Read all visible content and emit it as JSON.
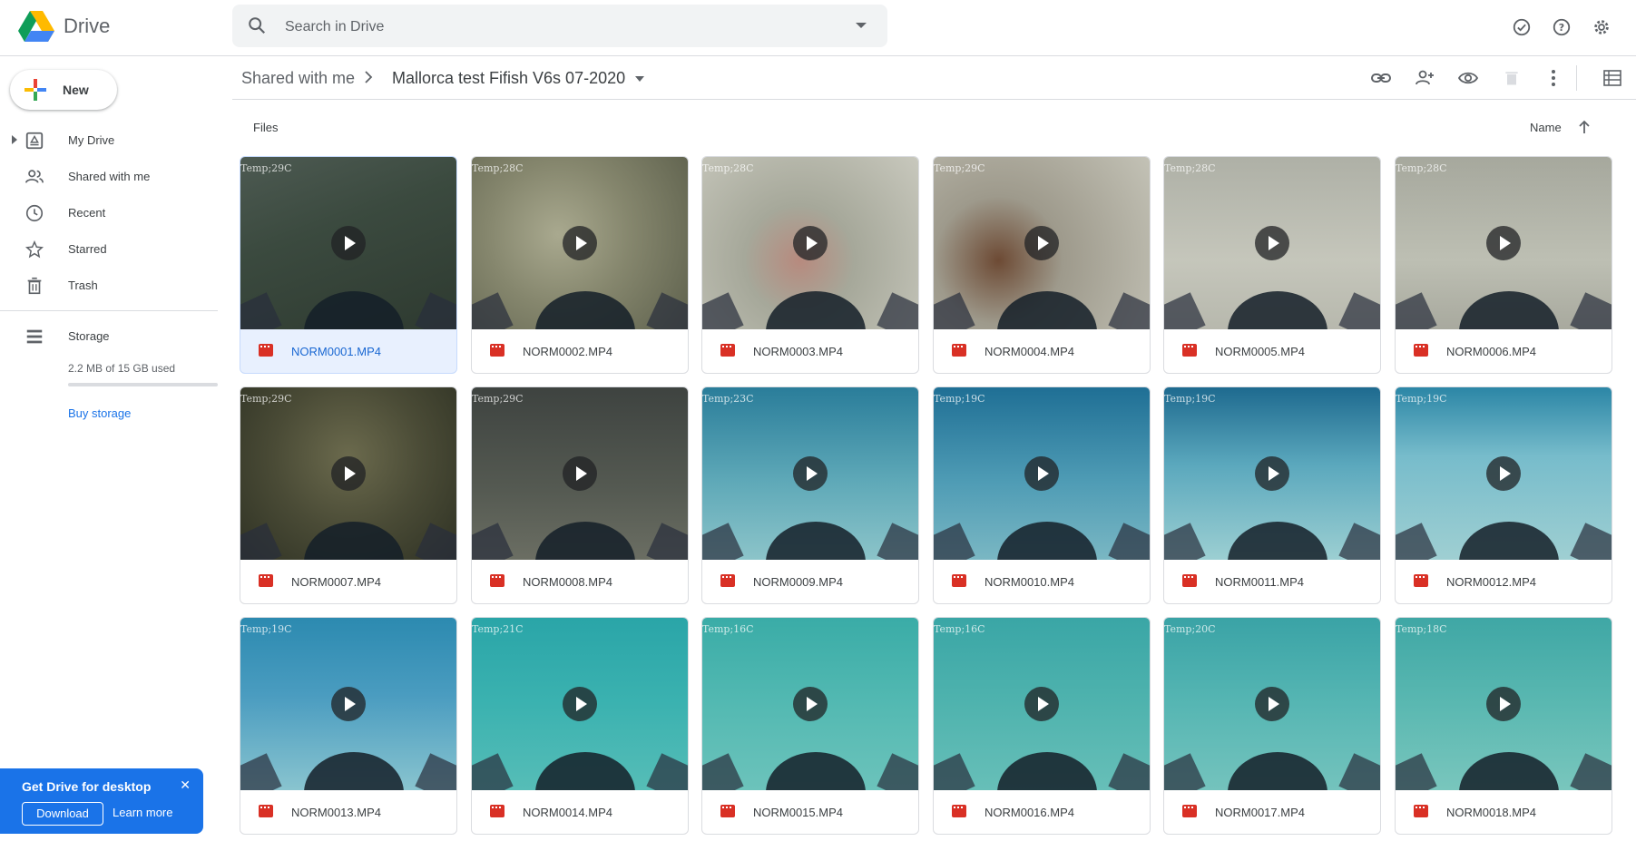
{
  "app": {
    "name": "Drive"
  },
  "search": {
    "placeholder": "Search in Drive"
  },
  "sidebar": {
    "new_label": "New",
    "items": [
      {
        "label": "My Drive"
      },
      {
        "label": "Shared with me"
      },
      {
        "label": "Recent"
      },
      {
        "label": "Starred"
      },
      {
        "label": "Trash"
      }
    ],
    "storage": {
      "label": "Storage",
      "used_text": "2.2 MB of 15 GB used",
      "used_fraction": 0.0001,
      "buy_label": "Buy storage"
    }
  },
  "promo": {
    "title": "Get Drive for desktop",
    "download_label": "Download",
    "learn_more_label": "Learn more"
  },
  "breadcrumb": {
    "parent": "Shared with me",
    "current": "Mallorca test Fifish V6s 07-2020"
  },
  "files_section": {
    "label": "Files",
    "sort_label": "Name"
  },
  "files": [
    {
      "name": "NORM0001.MP4",
      "osd": "Temp;29C",
      "selected": true,
      "bg": "linear-gradient(160deg,#4d5a52 0%,#3b4a3f 40%,#2e3a30 100%)"
    },
    {
      "name": "NORM0002.MP4",
      "osd": "Temp;28C",
      "selected": false,
      "bg": "radial-gradient(circle at 40% 45%,#a9a98f 0%,#85866d 45%,#5e614d 100%)"
    },
    {
      "name": "NORM0003.MP4",
      "osd": "Temp;28C",
      "selected": false,
      "bg": "radial-gradient(circle at 45% 60%,#b78a7e 0%,#a6a89a 35%,#c8c8bd 100%)"
    },
    {
      "name": "NORM0004.MP4",
      "osd": "Temp;29C",
      "selected": false,
      "bg": "radial-gradient(circle at 30% 60%,#6d4a34 0%,#9e9a8c 35%,#c3c2b6 100%)"
    },
    {
      "name": "NORM0005.MP4",
      "osd": "Temp;28C",
      "selected": false,
      "bg": "linear-gradient(180deg,#aeb0a6 0%,#c5c6bb 60%,#b7b8ad 100%)"
    },
    {
      "name": "NORM0006.MP4",
      "osd": "Temp;28C",
      "selected": false,
      "bg": "linear-gradient(180deg,#a6a89d 0%,#bdbfb3 60%,#a8a99e 100%)"
    },
    {
      "name": "NORM0007.MP4",
      "osd": "Temp;29C",
      "selected": false,
      "bg": "radial-gradient(circle at 50% 40%,#6b6a4d 0%,#4a4b36 50%,#2f3224 100%)"
    },
    {
      "name": "NORM0008.MP4",
      "osd": "Temp;29C",
      "selected": false,
      "bg": "linear-gradient(180deg,#3e4340 0%,#555a52 60%,#6b6e63 100%)"
    },
    {
      "name": "NORM0009.MP4",
      "osd": "Temp;23C",
      "selected": false,
      "bg": "linear-gradient(180deg,#2a7d9a 0%,#5fa9b8 55%,#8cc4c9 100%)"
    },
    {
      "name": "NORM0010.MP4",
      "osd": "Temp;19C",
      "selected": false,
      "bg": "linear-gradient(180deg,#1f6f95 0%,#4f9cb5 55%,#7ab7c3 100%)"
    },
    {
      "name": "NORM0011.MP4",
      "osd": "Temp;19C",
      "selected": false,
      "bg": "linear-gradient(180deg,#1e6a8f 0%,#5ba8bd 45%,#9ccfd2 100%)"
    },
    {
      "name": "NORM0012.MP4",
      "osd": "Temp;19C",
      "selected": false,
      "bg": "linear-gradient(180deg,#2b86a6 0%,#77bccb 40%,#9fcfd2 100%)"
    },
    {
      "name": "NORM0013.MP4",
      "osd": "Temp;19C",
      "selected": false,
      "bg": "linear-gradient(180deg,#2c8ab0 0%,#4a9cc0 45%,#89c4cf 100%)"
    },
    {
      "name": "NORM0014.MP4",
      "osd": "Temp;21C",
      "selected": false,
      "bg": "linear-gradient(180deg,#2aa5a8 0%,#3bb2b0 50%,#56bdb7 100%)"
    },
    {
      "name": "NORM0015.MP4",
      "osd": "Temp;16C",
      "selected": false,
      "bg": "linear-gradient(180deg,#3aaca7 0%,#53b9b2 50%,#6cc3bb 100%)"
    },
    {
      "name": "NORM0016.MP4",
      "osd": "Temp;16C",
      "selected": false,
      "bg": "linear-gradient(180deg,#3aa6a6 0%,#4fb3ae 50%,#67bfb8 100%)"
    },
    {
      "name": "NORM0017.MP4",
      "osd": "Temp;20C",
      "selected": false,
      "bg": "linear-gradient(180deg,#3aa3a6 0%,#56b6b3 50%,#74c3bd 100%)"
    },
    {
      "name": "NORM0018.MP4",
      "osd": "Temp;18C",
      "selected": false,
      "bg": "linear-gradient(180deg,#3fa7a5 0%,#5ab8b1 50%,#79c6bd 100%)"
    }
  ],
  "colors": {
    "accent": "#1a73e8",
    "video_icon": "#d93025",
    "selected_bg": "#e8f0fe"
  }
}
